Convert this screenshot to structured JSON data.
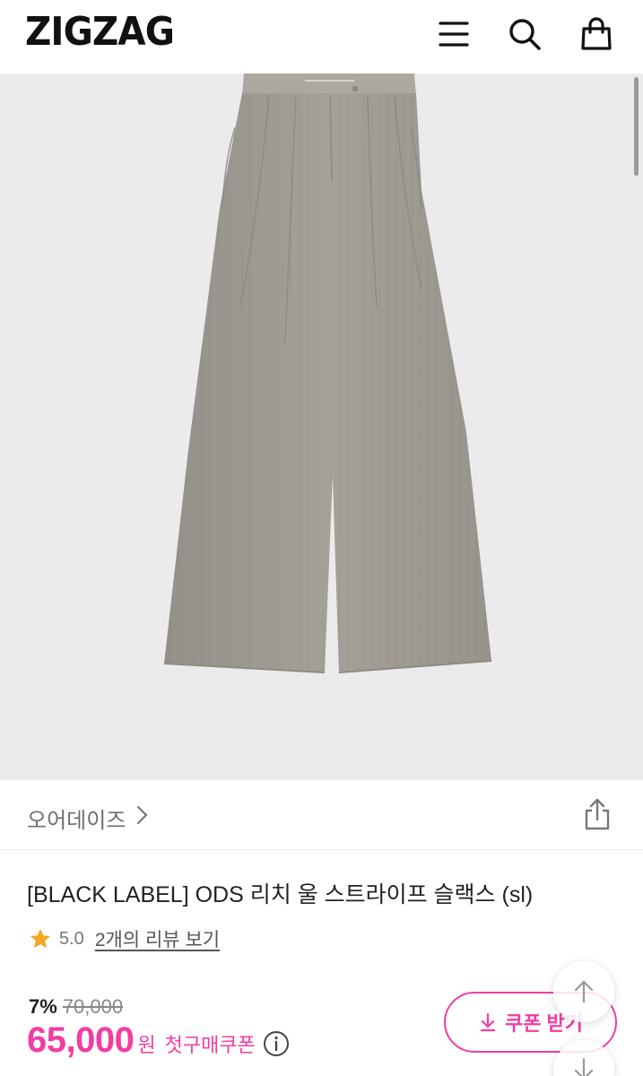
{
  "header": {
    "logo": "ZIGZAG",
    "icons": [
      "menu-icon",
      "search-icon",
      "shopping-bag-icon"
    ]
  },
  "brand": {
    "name": "오어데이즈",
    "chevron_icon": "chevron-right-icon",
    "share_icon": "share-icon"
  },
  "product": {
    "title": "[BLACK LABEL] ODS 리치 울 스트라이프 슬랙스 (sl)",
    "rating": "5.0",
    "review_link": "2개의 리뷰 보기"
  },
  "price": {
    "discount_rate": "7%",
    "original_price": "70,000",
    "sale_price": "65,000",
    "currency": "원",
    "coupon_note": "첫구매쿠폰"
  },
  "coupon_button": {
    "label": "쿠폰 받기"
  },
  "colors": {
    "accent": "#f23da3",
    "image_background": "#ebebeb",
    "pants": "#a39e95"
  }
}
